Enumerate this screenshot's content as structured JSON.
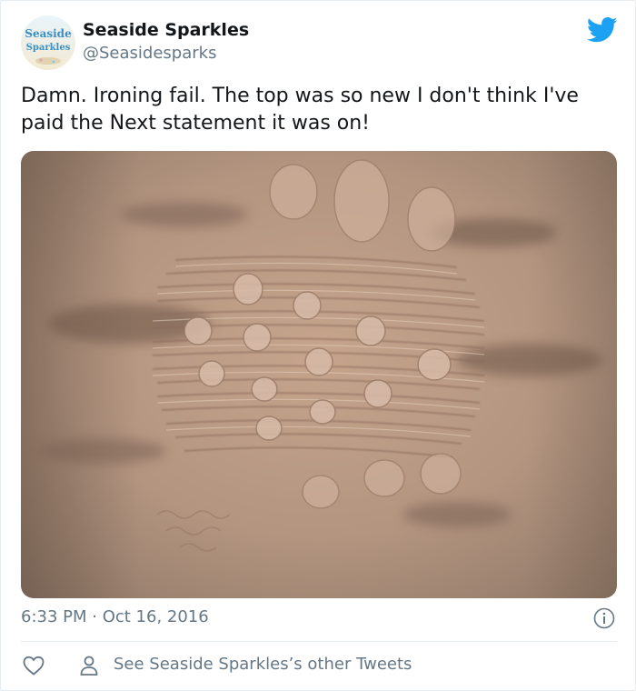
{
  "author": {
    "display_name": "Seaside Sparkles",
    "handle": "@Seasidesparks",
    "avatar_text_line1": "Seaside",
    "avatar_text_line2": "Sparkles"
  },
  "tweet": {
    "text": "Damn.  Ironing fail.  The top was so new I don't think I've paid the Next statement it was on!",
    "time": "6:33 PM · Oct 16, 2016"
  },
  "footer": {
    "other_tweets_label": "See Seaside Sparkles’s other Tweets"
  },
  "icons": {
    "brand": "twitter-bird-icon",
    "info": "info-icon",
    "like": "heart-icon",
    "profile": "person-icon"
  },
  "colors": {
    "brand_blue": "#1da1f2",
    "text": "#14171a",
    "muted": "#657786"
  }
}
